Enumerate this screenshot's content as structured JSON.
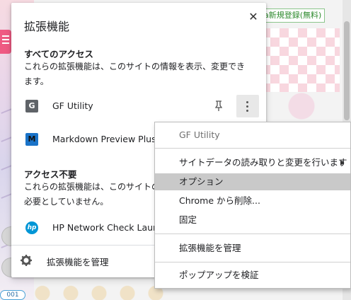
{
  "page": {
    "register_button": "a新規登録(無料)",
    "page_badge": "001"
  },
  "popup": {
    "title": "拡張機能",
    "close_glyph": "✕",
    "access_all": {
      "heading": "すべてのアクセス",
      "description": "これらの拡張機能は、このサイトの情報を表示、変更できます。"
    },
    "access_none": {
      "heading": "アクセス不要",
      "description": "これらの拡張機能は、このサイトの情報を表示、変更する必要としていません。"
    },
    "extensions_all": [
      {
        "name": "GF Utility",
        "icon": "G",
        "icon_bg": "#5f6368",
        "icon_fg": "#ffffff"
      },
      {
        "name": "Markdown Preview Plus",
        "icon": "M",
        "icon_bg": "#1a73c8",
        "icon_fg": "#111111"
      }
    ],
    "extensions_none": [
      {
        "name": "HP Network Check Launcher",
        "icon": "hp",
        "icon_bg": "#0096d6",
        "icon_fg": "#ffffff"
      }
    ],
    "manage_label": "拡張機能を管理"
  },
  "context_menu": {
    "header": "GF Utility",
    "items": [
      {
        "label": "サイトデータの読み取りと変更を行います",
        "submenu": true
      },
      {
        "label": "オプション",
        "highlighted": true
      },
      {
        "label": "Chrome から削除..."
      },
      {
        "label": "固定"
      },
      {
        "label": "拡張機能を管理"
      },
      {
        "label": "ポップアップを検証"
      }
    ]
  }
}
